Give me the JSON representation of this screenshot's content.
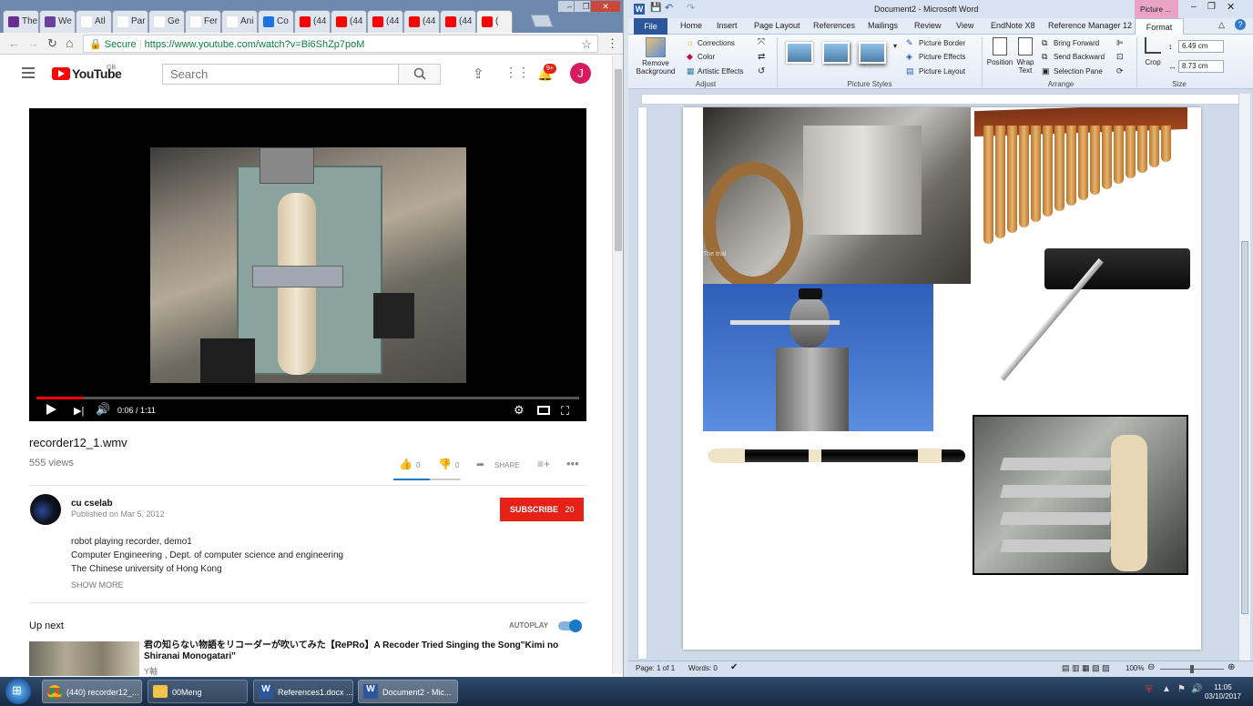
{
  "browser": {
    "tabs": [
      {
        "label": "The",
        "color": "#6a2c91"
      },
      {
        "label": "We",
        "color": "#6b3fa0"
      },
      {
        "label": "Atl",
        "color": "#ffffff"
      },
      {
        "label": "Par",
        "color": "#ffffff"
      },
      {
        "label": "Ge",
        "color": "#ffffff"
      },
      {
        "label": "Fer",
        "color": "#ffffff"
      },
      {
        "label": "Ani",
        "color": "#ffffff"
      },
      {
        "label": "Co",
        "color": "#1a73e8"
      },
      {
        "label": "(44",
        "color": "#ff0000"
      },
      {
        "label": "(44",
        "color": "#ff0000"
      },
      {
        "label": "(44",
        "color": "#ff0000"
      },
      {
        "label": "(44",
        "color": "#ff0000"
      },
      {
        "label": "(44",
        "color": "#ff0000"
      },
      {
        "label": "(",
        "color": "#ff0000"
      }
    ],
    "secure_label": "Secure",
    "url": "https://www.youtube.com/watch?v=Bi6ShZp7poM"
  },
  "youtube": {
    "logo_text": "YouTube",
    "region": "GB",
    "search_placeholder": "Search",
    "notification_count": "9+",
    "avatar_letter": "J",
    "player": {
      "time": "0:06 / 1:11",
      "progress": 0.085
    },
    "video_title": "recorder12_1.wmv",
    "views": "555 views",
    "likes": "0",
    "dislikes": "0",
    "share_label": "SHARE",
    "channel": {
      "name": "cu cselab",
      "published": "Published on Mar 5, 2012",
      "subscribe_label": "SUBSCRIBE",
      "subscriber_count": "20"
    },
    "description": [
      "robot playing recorder, demo1",
      "Computer Engineering , Dept. of computer science and engineering",
      "The Chinese university of Hong Kong"
    ],
    "show_more": "SHOW MORE",
    "up_next_label": "Up next",
    "autoplay_label": "AUTOPLAY",
    "next_video": {
      "title": "君の知らない物語をリコーダーが吹いてみた【RePRo】A Recoder Tried Singing the Song\"Kimi no Shiranai Monogatari\"",
      "channel": "Y軸"
    }
  },
  "word": {
    "title": "Document2 - Microsoft Word",
    "contextual_tab": "Picture ...",
    "tabs": [
      "File",
      "Home",
      "Insert",
      "Page Layout",
      "References",
      "Mailings",
      "Review",
      "View",
      "EndNote X8",
      "Reference Manager 12",
      "Format"
    ],
    "ribbon": {
      "remove_bg": "Remove Background",
      "corrections": "Corrections",
      "color": "Color",
      "artistic": "Artistic Effects",
      "adjust_label": "Adjust",
      "picture_border": "Picture Border",
      "picture_effects": "Picture Effects",
      "picture_layout": "Picture Layout",
      "styles_label": "Picture Styles",
      "position": "Position",
      "wrap_text": "Wrap Text",
      "bring_forward": "Bring Forward",
      "send_backward": "Send Backward",
      "selection_pane": "Selection Pane",
      "arrange_label": "Arrange",
      "crop": "Crop",
      "height": "6.49 cm",
      "width": "8.73 cm",
      "size_label": "Size"
    },
    "overlay_text": "The trial",
    "status": {
      "page": "Page: 1 of 1",
      "words": "Words: 0",
      "zoom": "100%"
    }
  },
  "taskbar": {
    "items": [
      "(440) recorder12_...",
      "00Meng",
      "References1.docx ...",
      "Document2 - Mic..."
    ],
    "time": "11:05",
    "date": "03/10/2017"
  }
}
